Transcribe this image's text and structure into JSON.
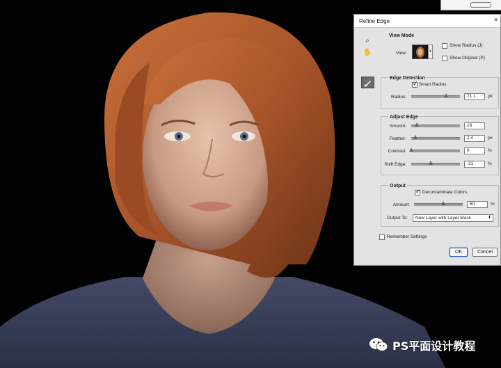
{
  "dialog": {
    "title": "Refine Edge",
    "close_glyph": "✕",
    "tools": [
      {
        "icon": "zoom-icon",
        "glyph": "⌕"
      },
      {
        "icon": "hand-icon",
        "glyph": "✋"
      },
      {
        "icon": "refine-radius-brush-icon",
        "glyph": "✎"
      }
    ],
    "view_mode": {
      "title": "View Mode",
      "view_label": "View:",
      "show_radius": {
        "label": "Show Radius (J)",
        "checked": false
      },
      "show_original": {
        "label": "Show Original (P)",
        "checked": false
      }
    },
    "edge_detection": {
      "title": "Edge Detection",
      "smart_radius": {
        "label": "Smart Radius",
        "checked": true
      },
      "radius": {
        "label": "Radius:",
        "value": "71.1",
        "unit": "px",
        "fraction": 0.72
      }
    },
    "adjust_edge": {
      "title": "Adjust Edge",
      "smooth": {
        "label": "Smooth:",
        "value": "16",
        "unit": "",
        "fraction": 0.12
      },
      "feather": {
        "label": "Feather:",
        "value": "2.4",
        "unit": "px",
        "fraction": 0.09
      },
      "contrast": {
        "label": "Contrast:",
        "value": "0",
        "unit": "%",
        "fraction": 0.0
      },
      "shift_edge": {
        "label": "Shift Edge:",
        "value": "-21",
        "unit": "%",
        "fraction": 0.4
      }
    },
    "output": {
      "title": "Output",
      "decontaminate": {
        "label": "Decontaminate Colors",
        "checked": true
      },
      "amount": {
        "label": "Amount:",
        "value": "60",
        "unit": "%",
        "fraction": 0.6
      },
      "output_to_label": "Output To:",
      "output_to_value": "New Layer with Layer Mask"
    },
    "remember": {
      "label": "Remember Settings",
      "checked": false
    },
    "ok_label": "OK",
    "cancel_label": "Cancel"
  },
  "watermark": {
    "text": "PS平面设计教程",
    "icon": "wechat-icon"
  },
  "colors": {
    "dialog_bg": "#e3e3e3",
    "hair": "#b0582a",
    "shirt": "#3a3f58",
    "background": "#000000",
    "accent": "#2b5fb0"
  }
}
